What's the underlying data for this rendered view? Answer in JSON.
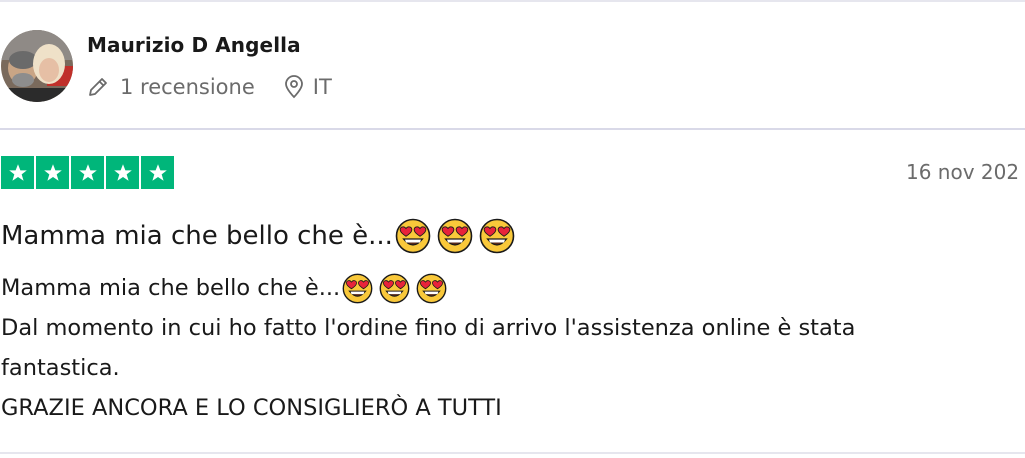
{
  "reviewer": {
    "name": "Maurizio D Angella",
    "review_count": "1 recensione",
    "country": "IT",
    "avatar_icon": "avatar-photo"
  },
  "rating": {
    "stars": 5,
    "max_stars": 5,
    "star_color": "#00b67a"
  },
  "review": {
    "date": "16 nov 202",
    "title": "Mamma mia che bello che è...",
    "title_emoji_icon": "heart-eyes-emoji",
    "title_emoji_count": 3,
    "body_line_1": "Mamma mia che bello che è...",
    "body_line_1_emoji_count": 3,
    "body_line_2": "Dal momento in cui ho fatto l'ordine fino di arrivo l'assistenza online è stata",
    "body_line_3": "fantastica.",
    "body_line_4": "GRAZIE ANCORA E LO CONSIGLIERÒ A TUTTI"
  },
  "icons": {
    "pencil": "pencil-icon",
    "location": "location-pin-icon",
    "star": "star-icon"
  }
}
